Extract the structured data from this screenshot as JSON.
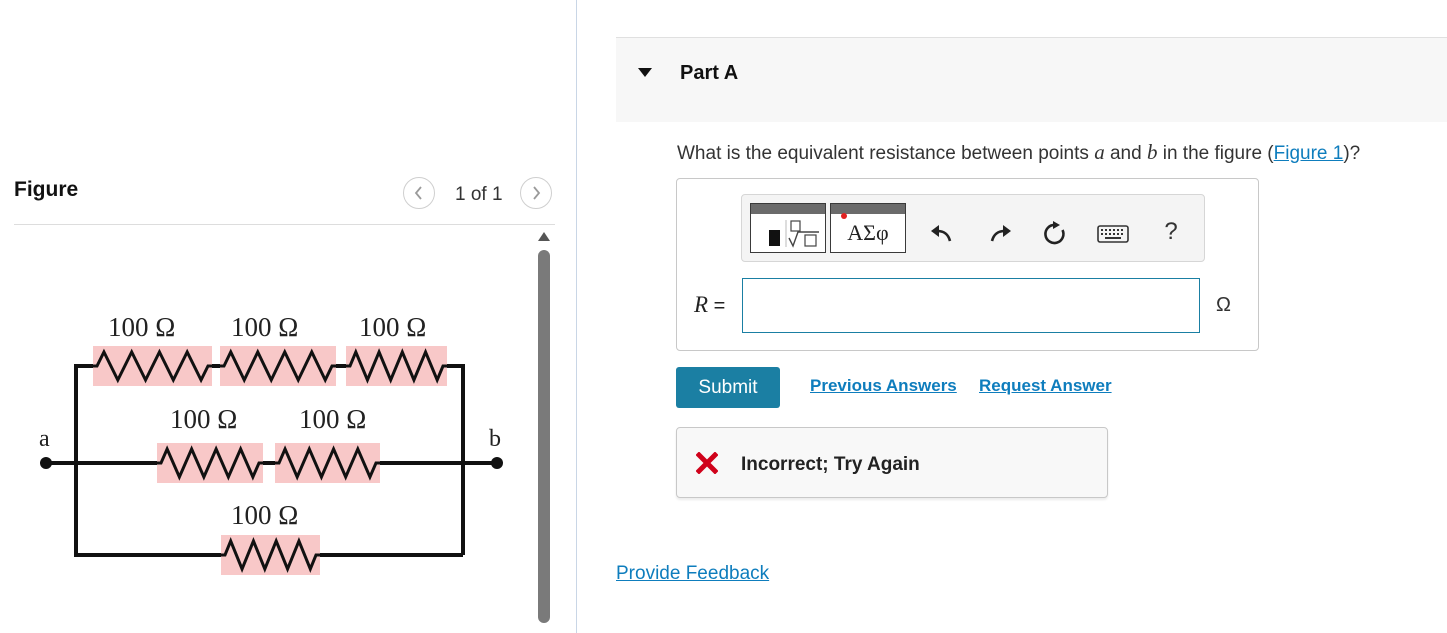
{
  "figure_panel": {
    "title": "Figure",
    "pager": "1 of 1",
    "circuit": {
      "point_a": "a",
      "point_b": "b",
      "top_branch_resistors": [
        "100 Ω",
        "100 Ω",
        "100 Ω"
      ],
      "middle_branch_resistors": [
        "100 Ω",
        "100 Ω"
      ],
      "bottom_branch_resistors": [
        "100 Ω"
      ],
      "wire_color": "#111111",
      "resistor_highlight_color": "#f8c8c8"
    }
  },
  "part": {
    "title": "Part A",
    "question": {
      "before": "What is the equivalent resistance between points ",
      "var_a": "a",
      "mid": " and ",
      "var_b": "b",
      "after": " in the figure (",
      "link": "Figure 1",
      "end": ")?"
    },
    "toolbar": {
      "symbols_label": "ΑΣφ",
      "help_label": "?",
      "icons": [
        "templates-icon",
        "symbols-icon",
        "undo-icon",
        "redo-icon",
        "reset-icon",
        "keyboard-icon",
        "help-icon"
      ]
    },
    "answer": {
      "variable": "R",
      "equals": " =",
      "value": "",
      "unit": "Ω"
    },
    "buttons": {
      "submit": "Submit",
      "previous_answers": "Previous Answers",
      "request_answer": "Request Answer"
    },
    "feedback": {
      "status": "Incorrect; Try Again",
      "status_color": "#d0021b"
    },
    "provide_feedback": "Provide Feedback"
  },
  "colors": {
    "accent": "#1b7fa3",
    "link": "#0e7dbd"
  }
}
